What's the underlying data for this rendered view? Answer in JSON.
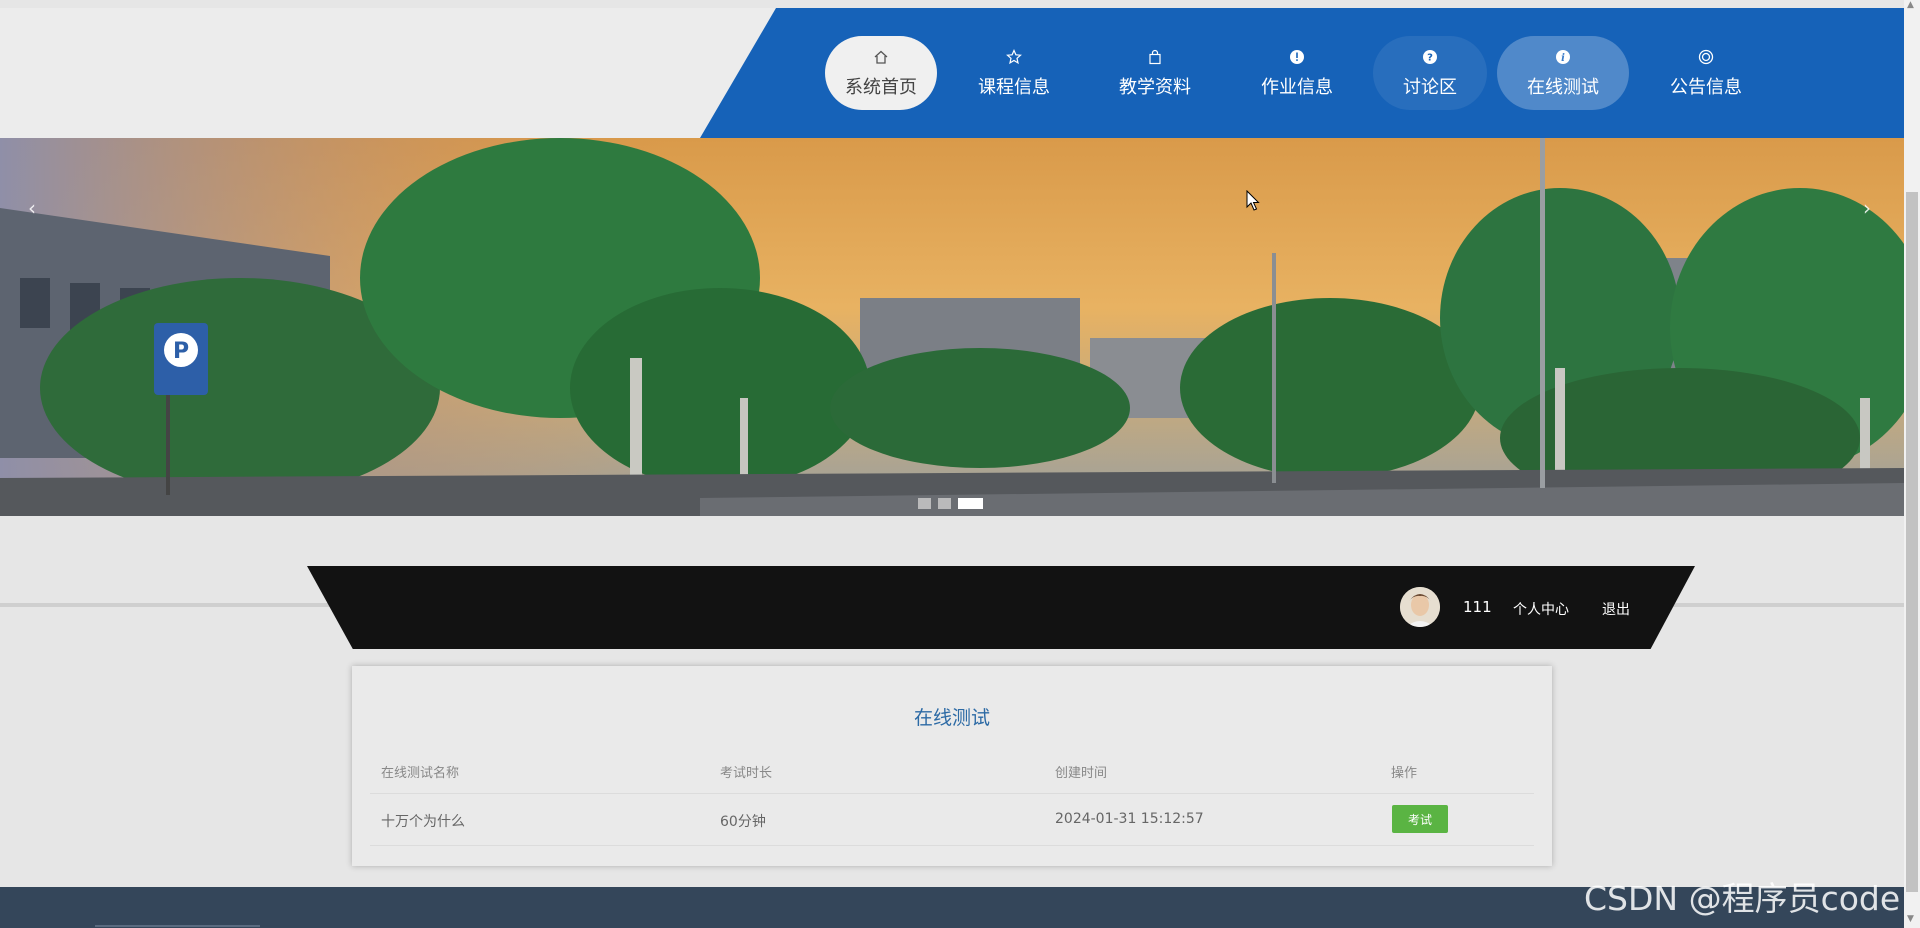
{
  "nav": {
    "items": [
      {
        "label": "系统首页",
        "icon": "home-icon"
      },
      {
        "label": "课程信息",
        "icon": "star-icon"
      },
      {
        "label": "教学资料",
        "icon": "bag-icon"
      },
      {
        "label": "作业信息",
        "icon": "alert-circle-icon"
      },
      {
        "label": "讨论区",
        "icon": "question-circle-icon"
      },
      {
        "label": "在线测试",
        "icon": "info-circle-icon"
      },
      {
        "label": "公告信息",
        "icon": "target-icon"
      }
    ],
    "active_label": "在线测试"
  },
  "banner": {
    "prev_arrow": "‹",
    "next_arrow": "›",
    "slide_count": 3,
    "active_slide": 3
  },
  "user": {
    "name": "111",
    "center_label": "个人中心",
    "logout_label": "退出"
  },
  "main": {
    "title": "在线测试",
    "table": {
      "headers": [
        "在线测试名称",
        "考试时长",
        "创建时间",
        "操作"
      ],
      "rows": [
        {
          "name": "十万个为什么",
          "duration": "60分钟",
          "created": "2024-01-31 15:12:57",
          "action": "考试"
        }
      ]
    }
  },
  "watermark": "CSDN @程序员code",
  "colors": {
    "nav_blue": "#1662b8",
    "title_blue": "#2c6aa5",
    "exam_green": "#5ab443",
    "footer": "#34465a"
  }
}
